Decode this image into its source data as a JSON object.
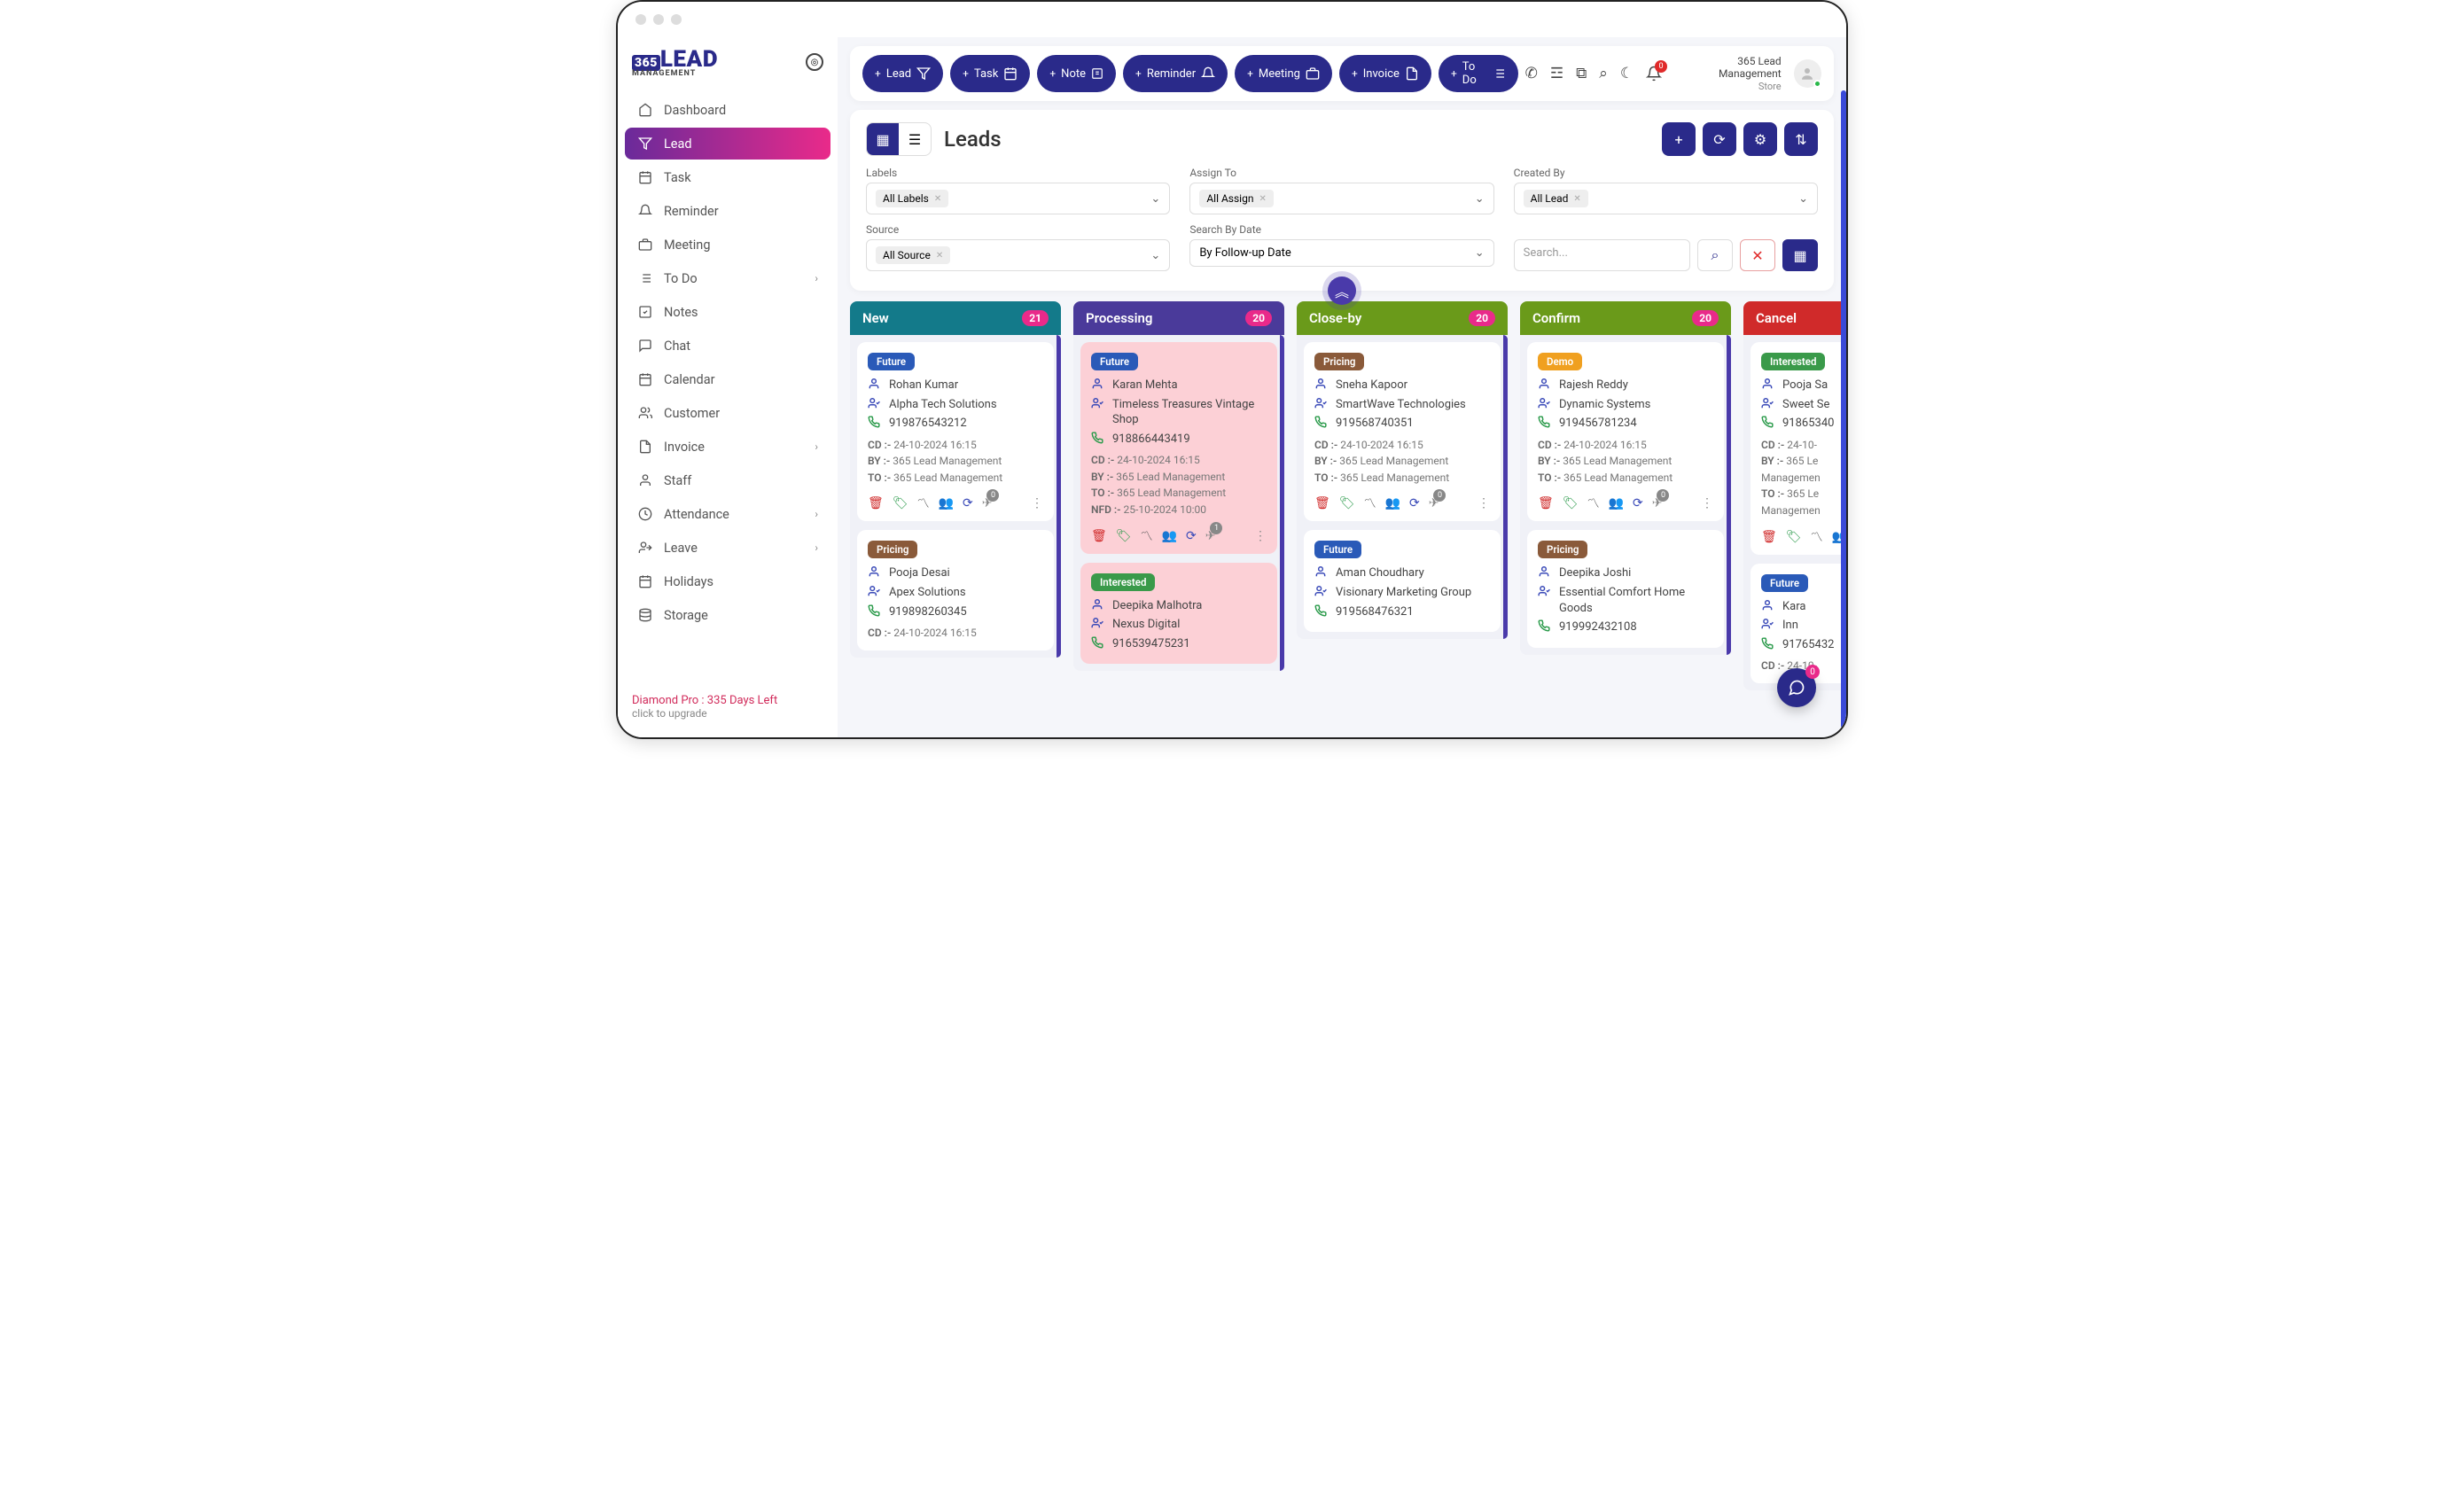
{
  "brand": {
    "name": "LEAD",
    "sub": "MANAGEMENT",
    "prefix": "365"
  },
  "sidebar": {
    "items": [
      {
        "icon": "home",
        "label": "Dashboard"
      },
      {
        "icon": "filter",
        "label": "Lead",
        "active": true
      },
      {
        "icon": "calendar",
        "label": "Task"
      },
      {
        "icon": "bell",
        "label": "Reminder"
      },
      {
        "icon": "briefcase",
        "label": "Meeting"
      },
      {
        "icon": "list",
        "label": "To Do",
        "chev": true
      },
      {
        "icon": "check",
        "label": "Notes"
      },
      {
        "icon": "chat",
        "label": "Chat"
      },
      {
        "icon": "calendar",
        "label": "Calendar"
      },
      {
        "icon": "users",
        "label": "Customer"
      },
      {
        "icon": "doc",
        "label": "Invoice",
        "chev": true
      },
      {
        "icon": "user",
        "label": "Staff"
      },
      {
        "icon": "clock",
        "label": "Attendance",
        "chev": true
      },
      {
        "icon": "exit",
        "label": "Leave",
        "chev": true
      },
      {
        "icon": "calendar",
        "label": "Holidays"
      },
      {
        "icon": "storage",
        "label": "Storage"
      }
    ],
    "plan": {
      "line1": "Diamond Pro : 335 Days Left",
      "line2": "click to upgrade"
    }
  },
  "topbar": {
    "pills": [
      {
        "label": "Lead",
        "icon": "filter",
        "plus": true
      },
      {
        "label": "Task",
        "icon": "calendar",
        "plus": true
      },
      {
        "label": "Note",
        "icon": "note",
        "plus": true
      },
      {
        "label": "Reminder",
        "icon": "bell",
        "plus": true
      },
      {
        "label": "Meeting",
        "icon": "briefcase",
        "plus": true
      },
      {
        "label": "Invoice",
        "icon": "doc",
        "plus": true
      },
      {
        "label": "To Do",
        "icon": "list",
        "plus": true
      }
    ],
    "notif_count": "0",
    "user": {
      "name": "365 Lead Management",
      "sub": "Store"
    }
  },
  "panel": {
    "title": "Leads",
    "filters": {
      "labels_lbl": "Labels",
      "labels_val": "All Labels",
      "assign_lbl": "Assign To",
      "assign_val": "All Assign",
      "created_lbl": "Created By",
      "created_val": "All Lead",
      "source_lbl": "Source",
      "source_val": "All Source",
      "date_lbl": "Search By Date",
      "date_val": "By Follow-up Date",
      "search_ph": "Search..."
    }
  },
  "columns": [
    {
      "title": "New",
      "count": "21",
      "color": "#137a8a",
      "stripe": "#4a3aaa",
      "cards": [
        {
          "tag": "Future",
          "tagc": "future",
          "name": "Rohan Kumar",
          "company": "Alpha Tech Solutions",
          "phone": "919876543212",
          "cd": "24-10-2024 16:15",
          "by": "365 Lead Management",
          "to": "365 Lead Management",
          "send": "0"
        },
        {
          "tag": "Pricing",
          "tagc": "pricing",
          "name": "Pooja Desai",
          "company": "Apex Solutions",
          "phone": "919898260345",
          "cd": "24-10-2024 16:15"
        }
      ]
    },
    {
      "title": "Processing",
      "count": "20",
      "color": "#4a3a9a",
      "stripe": "#4a3aaa",
      "cards": [
        {
          "pink": true,
          "tag": "Future",
          "tagc": "future",
          "name": "Karan Mehta",
          "company": "Timeless Treasures Vintage Shop",
          "phone": "918866443419",
          "cd": "24-10-2024 16:15",
          "by": "365 Lead Management",
          "to": "365 Lead Management",
          "nfd": "25-10-2024 10:00",
          "send": "1"
        },
        {
          "pink": true,
          "tag": "Interested",
          "tagc": "interested",
          "name": "Deepika Malhotra",
          "company": "Nexus Digital",
          "phone": "916539475231"
        }
      ]
    },
    {
      "title": "Close-by",
      "count": "20",
      "color": "#6a9a1a",
      "stripe": "#4a3aaa",
      "cards": [
        {
          "tag": "Pricing",
          "tagc": "pricing",
          "name": "Sneha Kapoor",
          "company": "SmartWave Technologies",
          "phone": "919568740351",
          "cd": "24-10-2024 16:15",
          "by": "365 Lead Management",
          "to": "365 Lead Management",
          "send": "0"
        },
        {
          "tag": "Future",
          "tagc": "future",
          "name": "Aman Choudhary",
          "company": "Visionary Marketing Group",
          "phone": "919568476321"
        }
      ]
    },
    {
      "title": "Confirm",
      "count": "20",
      "color": "#6a9a1a",
      "stripe": "#4a3aaa",
      "cards": [
        {
          "tag": "Demo",
          "tagc": "demo",
          "name": "Rajesh Reddy",
          "company": "Dynamic Systems",
          "phone": "919456781234",
          "cd": "24-10-2024 16:15",
          "by": "365 Lead Management",
          "to": "365 Lead Management",
          "send": "0"
        },
        {
          "tag": "Pricing",
          "tagc": "pricing",
          "name": "Deepika Joshi",
          "company": "Essential Comfort Home Goods",
          "phone": "919992432108"
        }
      ]
    },
    {
      "title": "Cancel",
      "count": "",
      "color": "#d02a2a",
      "stripe": "#4a3aaa",
      "cards": [
        {
          "tag": "Interested",
          "tagc": "interested",
          "name": "Pooja Sa",
          "company": "Sweet Se",
          "phone": "91865340",
          "cd": "24-10-",
          "by": "365 Le",
          "by2": "Managemen",
          "to": "365 Le",
          "to2": "Managemen"
        },
        {
          "tag": "Future",
          "tagc": "future",
          "name": "Kara",
          "company": "Inn",
          "phone": "91765432",
          "cd": "24-10-"
        }
      ]
    }
  ],
  "fab_count": "0"
}
